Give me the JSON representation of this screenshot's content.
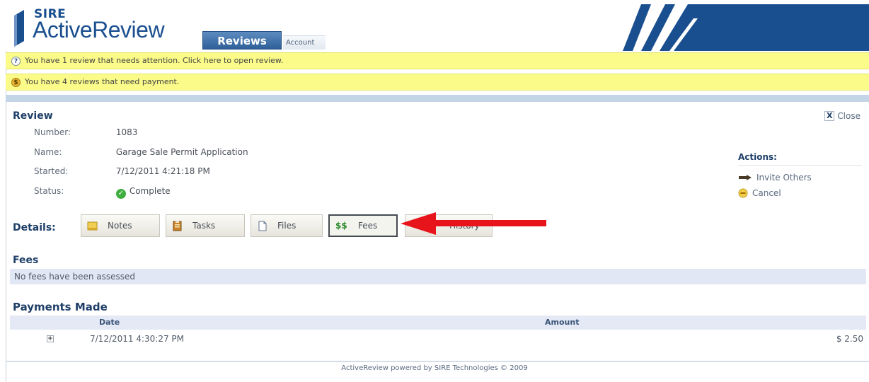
{
  "header": {
    "brand_small": "SIRE",
    "brand_title": "ActiveReview",
    "tabs": [
      {
        "label": "Reviews",
        "active": true
      },
      {
        "label": "Account",
        "active": false
      }
    ],
    "brand_color": "#1a4f8f"
  },
  "alerts": [
    {
      "icon": "question-icon",
      "text": "You have 1 review that needs attention. Click here to open review."
    },
    {
      "icon": "dollar-icon",
      "text": "You have 4 reviews that need payment."
    }
  ],
  "review": {
    "title": "Review",
    "close_label": "Close",
    "fields": [
      {
        "label": "Number:",
        "value": "1083"
      },
      {
        "label": "Name:",
        "value": "Garage Sale Permit Application"
      },
      {
        "label": "Started:",
        "value": "7/12/2011 4:21:18 PM"
      },
      {
        "label": "Status:",
        "value": "Complete"
      }
    ]
  },
  "actions": {
    "title": "Actions:",
    "items": [
      {
        "icon": "invite-icon",
        "label": "Invite Others"
      },
      {
        "icon": "cancel-icon",
        "label": "Cancel"
      }
    ]
  },
  "details": {
    "label": "Details:",
    "buttons": [
      {
        "icon": "notes-icon",
        "label": "Notes"
      },
      {
        "icon": "tasks-icon",
        "label": "Tasks"
      },
      {
        "icon": "files-icon",
        "label": "Files"
      },
      {
        "icon": "fees-icon",
        "glyph": "$$",
        "label": "Fees",
        "active": true
      },
      {
        "icon": "history-icon",
        "label": "History"
      }
    ]
  },
  "fees": {
    "title": "Fees",
    "empty_text": "No fees have been assessed"
  },
  "payments": {
    "title": "Payments Made",
    "columns": [
      "Date",
      "Amount"
    ],
    "rows": [
      {
        "date": "7/12/2011 4:30:27 PM",
        "amount": "$ 2.50"
      }
    ]
  },
  "footer": {
    "text": "ActiveReview powered by SIRE Technologies © 2009"
  },
  "colors": {
    "alert_bg": "#fbfb8a",
    "accent": "#1f3f68",
    "annotation_arrow": "#e8141c"
  }
}
